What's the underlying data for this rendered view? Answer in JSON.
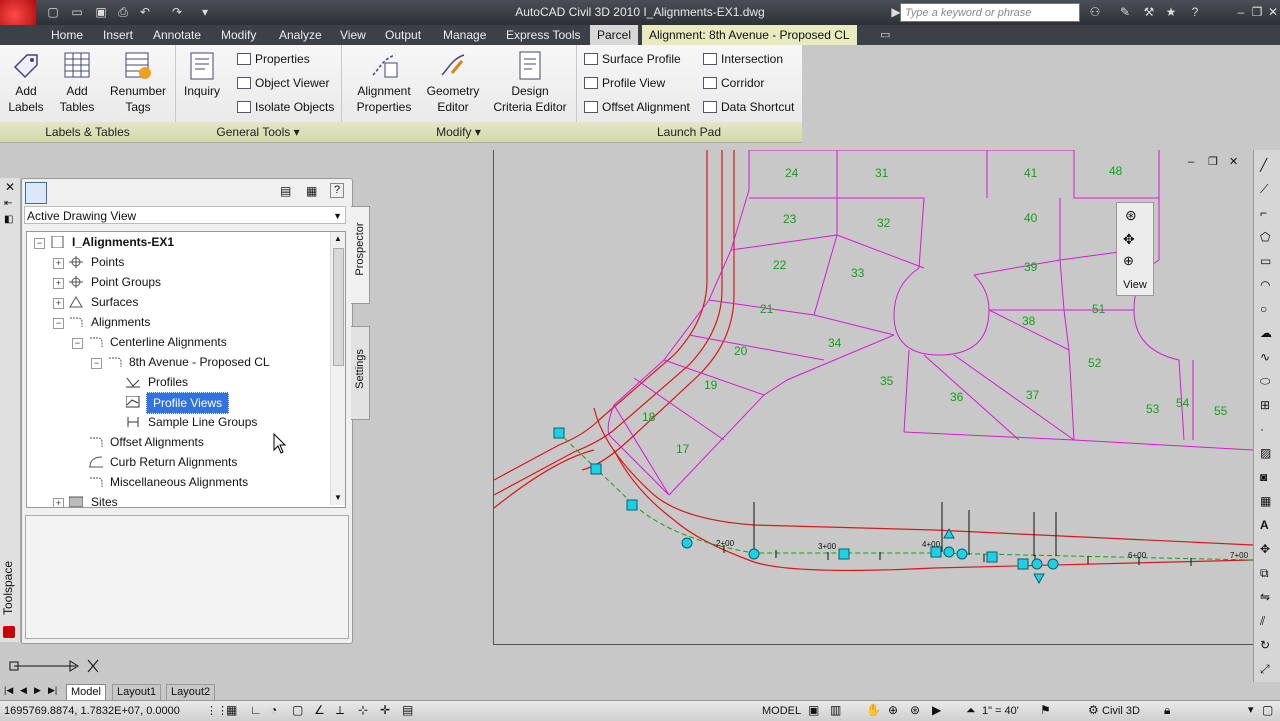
{
  "window": {
    "title": "AutoCAD Civil 3D 2010    I_Alignments-EX1.dwg",
    "search_placeholder": "Type a keyword or phrase"
  },
  "tabs": [
    {
      "label": "Home"
    },
    {
      "label": "Insert"
    },
    {
      "label": "Annotate"
    },
    {
      "label": "Modify"
    },
    {
      "label": "Analyze"
    },
    {
      "label": "View"
    },
    {
      "label": "Output"
    },
    {
      "label": "Manage"
    },
    {
      "label": "Express Tools"
    },
    {
      "label": "Parcel"
    },
    {
      "label": "Alignment: 8th Avenue - Proposed CL"
    }
  ],
  "ribbon": {
    "labels_tables": {
      "title": "Labels & Tables",
      "add_labels": "Add\nLabels",
      "add_tables": "Add\nTables",
      "renumber_tags": "Renumber\nTags"
    },
    "general_tools": {
      "title": "General Tools",
      "inquiry": "Inquiry",
      "properties": "Properties",
      "object_viewer": "Object Viewer",
      "isolate_objects": "Isolate Objects"
    },
    "modify": {
      "title": "Modify",
      "alignment_properties": "Alignment\nProperties",
      "geometry_editor": "Geometry\nEditor",
      "design_criteria_editor": "Design\nCriteria Editor"
    },
    "launch_pad": {
      "title": "Launch Pad",
      "surface_profile": "Surface Profile",
      "profile_view": "Profile View",
      "offset_alignment": "Offset Alignment",
      "intersection": "Intersection",
      "corridor": "Corridor",
      "data_shortcut": "Data Shortcut"
    }
  },
  "toolspace": {
    "title": "Toolspace",
    "dropdown": "Active Drawing View",
    "side_tabs": {
      "prospector": "Prospector",
      "settings": "Settings"
    },
    "tree": {
      "root": "I_Alignments-EX1",
      "points": "Points",
      "point_groups": "Point Groups",
      "surfaces": "Surfaces",
      "alignments": "Alignments",
      "centerline": "Centerline Alignments",
      "eighth_avenue": "8th Avenue - Proposed CL",
      "profiles": "Profiles",
      "profile_views": "Profile Views",
      "sample_line_groups": "Sample Line Groups",
      "offset": "Offset Alignments",
      "curb_return": "Curb Return Alignments",
      "misc": "Miscellaneous Alignments",
      "sites": "Sites"
    }
  },
  "drawing": {
    "view_label": "View",
    "parcels_left": [
      "24",
      "31",
      "23",
      "32",
      "22",
      "33",
      "21",
      "34",
      "20",
      "19",
      "35",
      "18",
      "36",
      "17",
      "37"
    ],
    "parcels_right": [
      "41",
      "48",
      "40",
      "39",
      "38",
      "51",
      "52",
      "53",
      "54",
      "55"
    ],
    "stations": [
      "2+00",
      "3+00",
      "4+00",
      "6+00",
      "7+00"
    ]
  },
  "layout_tabs": [
    "Model",
    "Layout1",
    "Layout2"
  ],
  "status": {
    "coords": "1695769.8874, 1.7832E+07, 0.0000",
    "model": "MODEL",
    "scale": "1\" = 40'",
    "workspace": "Civil 3D"
  },
  "colors": {
    "parcel": "#d61ad6",
    "road": "#d61a1a",
    "alignment": "#16a016",
    "grip": "#1ed0e6",
    "selection": "#3373e0"
  }
}
